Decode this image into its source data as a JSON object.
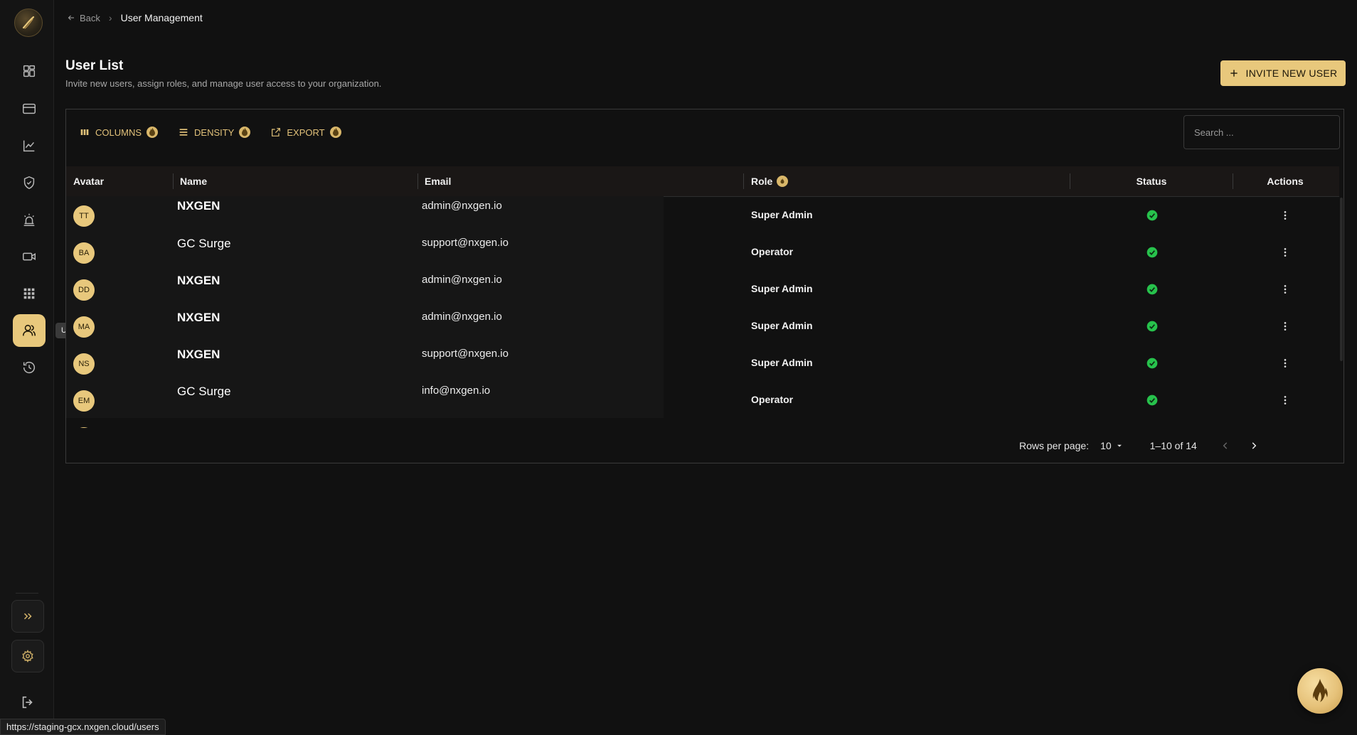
{
  "breadcrumb": {
    "back_label": "Back",
    "current": "User Management"
  },
  "header": {
    "title": "User List",
    "subtitle": "Invite new users, assign roles, and manage user access to your organization.",
    "invite_label": "INVITE NEW USER"
  },
  "sidebar": {
    "tooltip": "Users",
    "items": [
      "dashboard-icon",
      "card-icon",
      "analytics-icon",
      "shield-icon",
      "alarm-icon",
      "camera-icon",
      "grid-icon",
      "users-icon",
      "history-icon"
    ]
  },
  "toolbar": {
    "columns_label": "COLUMNS",
    "density_label": "DENSITY",
    "export_label": "EXPORT"
  },
  "search": {
    "placeholder": "Search ..."
  },
  "table": {
    "headers": {
      "avatar": "Avatar",
      "name": "Name",
      "email": "Email",
      "role": "Role",
      "status": "Status",
      "actions": "Actions"
    },
    "rows": [
      {
        "initials": "TT",
        "name": "NXGEN",
        "email": "admin@nxgen.io",
        "role": "Super Admin",
        "status": "active"
      },
      {
        "initials": "BA",
        "name": "GC Surge",
        "email": "support@nxgen.io",
        "role": "Operator",
        "status": "active"
      },
      {
        "initials": "DD",
        "name": "NXGEN",
        "email": "admin@nxgen.io",
        "role": "Super Admin",
        "status": "active"
      },
      {
        "initials": "MA",
        "name": "NXGEN",
        "email": "admin@nxgen.io",
        "role": "Super Admin",
        "status": "active"
      },
      {
        "initials": "NS",
        "name": "NXGEN",
        "email": "support@nxgen.io",
        "role": "Super Admin",
        "status": "active"
      },
      {
        "initials": "EM",
        "name": "GC Surge",
        "email": "info@nxgen.io",
        "role": "Operator",
        "status": "active"
      }
    ]
  },
  "pagination": {
    "rows_per_page_label": "Rows per page:",
    "rows_per_page": "10",
    "range": "1–10 of 14"
  },
  "status_bar": {
    "url": "https://staging-gcx.nxgen.cloud/users"
  },
  "colors": {
    "accent": "#e8c87c",
    "status_ok": "#27c24c",
    "background": "#111111"
  }
}
